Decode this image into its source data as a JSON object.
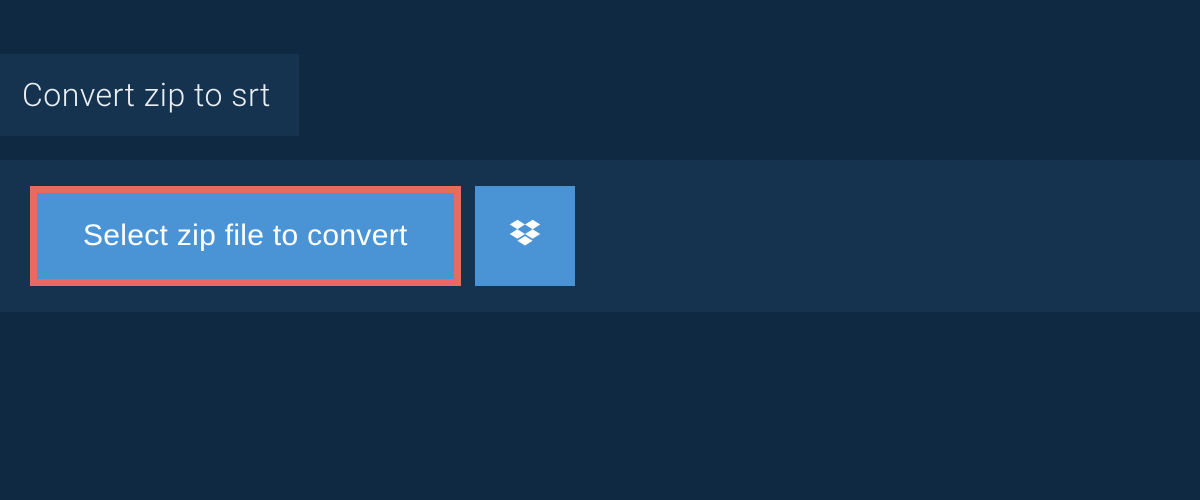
{
  "header": {
    "title": "Convert zip to srt"
  },
  "upload": {
    "select_label": "Select zip file to convert",
    "dropbox_icon": "dropbox-icon"
  },
  "colors": {
    "bg": "#102942",
    "panel": "#15334f",
    "button": "#4a94d6",
    "highlight_border": "#e86b63",
    "text_light": "#e8eef4",
    "text_white": "#ffffff"
  }
}
